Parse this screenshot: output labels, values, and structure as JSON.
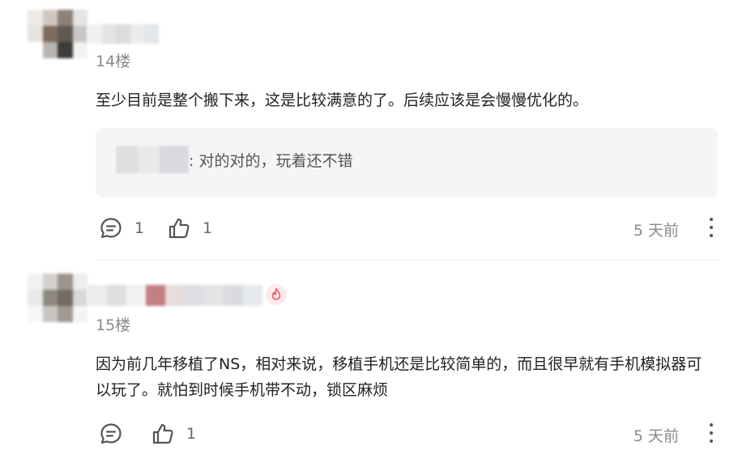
{
  "comments": [
    {
      "floor": "14楼",
      "text": "至少目前是整个搬下来，这是比较满意的了。后续应该是会慢慢优化的。",
      "reply": {
        "text": ": 对的对的，玩着还不错"
      },
      "reply_count": "1",
      "like_count": "1",
      "time": "5 天前"
    },
    {
      "floor": "15楼",
      "text": "因为前几年移植了NS，相对来说，移植手机还是比较简单的，而且很早就有手机模拟器可以玩了。就怕到时候手机带不动，锁区麻烦",
      "reply_count": "",
      "like_count": "1",
      "time": "5 天前"
    }
  ],
  "icons": {
    "comment": "comment-bubble-icon",
    "like": "thumbs-up-icon",
    "more": "more-vertical-icon",
    "badge": "flame-badge-icon"
  },
  "colors": {
    "meta_text": "#8a8a8a",
    "body_text": "#222222",
    "reply_bg": "#f4f5f7",
    "badge": "#f0566a"
  }
}
